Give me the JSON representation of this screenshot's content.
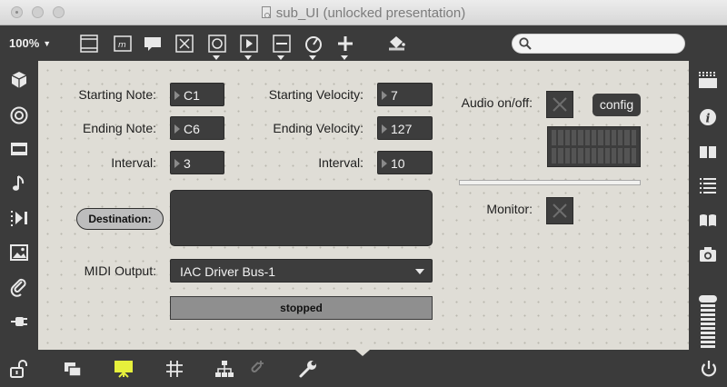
{
  "window": {
    "title": "sub_UI (unlocked presentation)"
  },
  "toolbar": {
    "zoom": "100%",
    "zoom_caret": "▼",
    "search_placeholder": ""
  },
  "patch": {
    "starting_note": {
      "label": "Starting Note:",
      "value": "C1"
    },
    "ending_note": {
      "label": "Ending Note:",
      "value": "C6"
    },
    "note_interval": {
      "label": "Interval:",
      "value": "3"
    },
    "starting_velocity": {
      "label": "Starting Velocity:",
      "value": "7"
    },
    "ending_velocity": {
      "label": "Ending Velocity:",
      "value": "127"
    },
    "velocity_interval": {
      "label": "Interval:",
      "value": "10"
    },
    "destination_label": "Destination:",
    "midi_output": {
      "label": "MIDI Output:",
      "value": "IAC Driver Bus-1"
    },
    "status": "stopped",
    "audio": {
      "label": "Audio on/off:",
      "config_label": "config"
    },
    "monitor": {
      "label": "Monitor:"
    }
  },
  "colors": {
    "canvas": "#dfddd6",
    "object": "#3d3d3d",
    "presentation_active": "#e6f03c"
  }
}
